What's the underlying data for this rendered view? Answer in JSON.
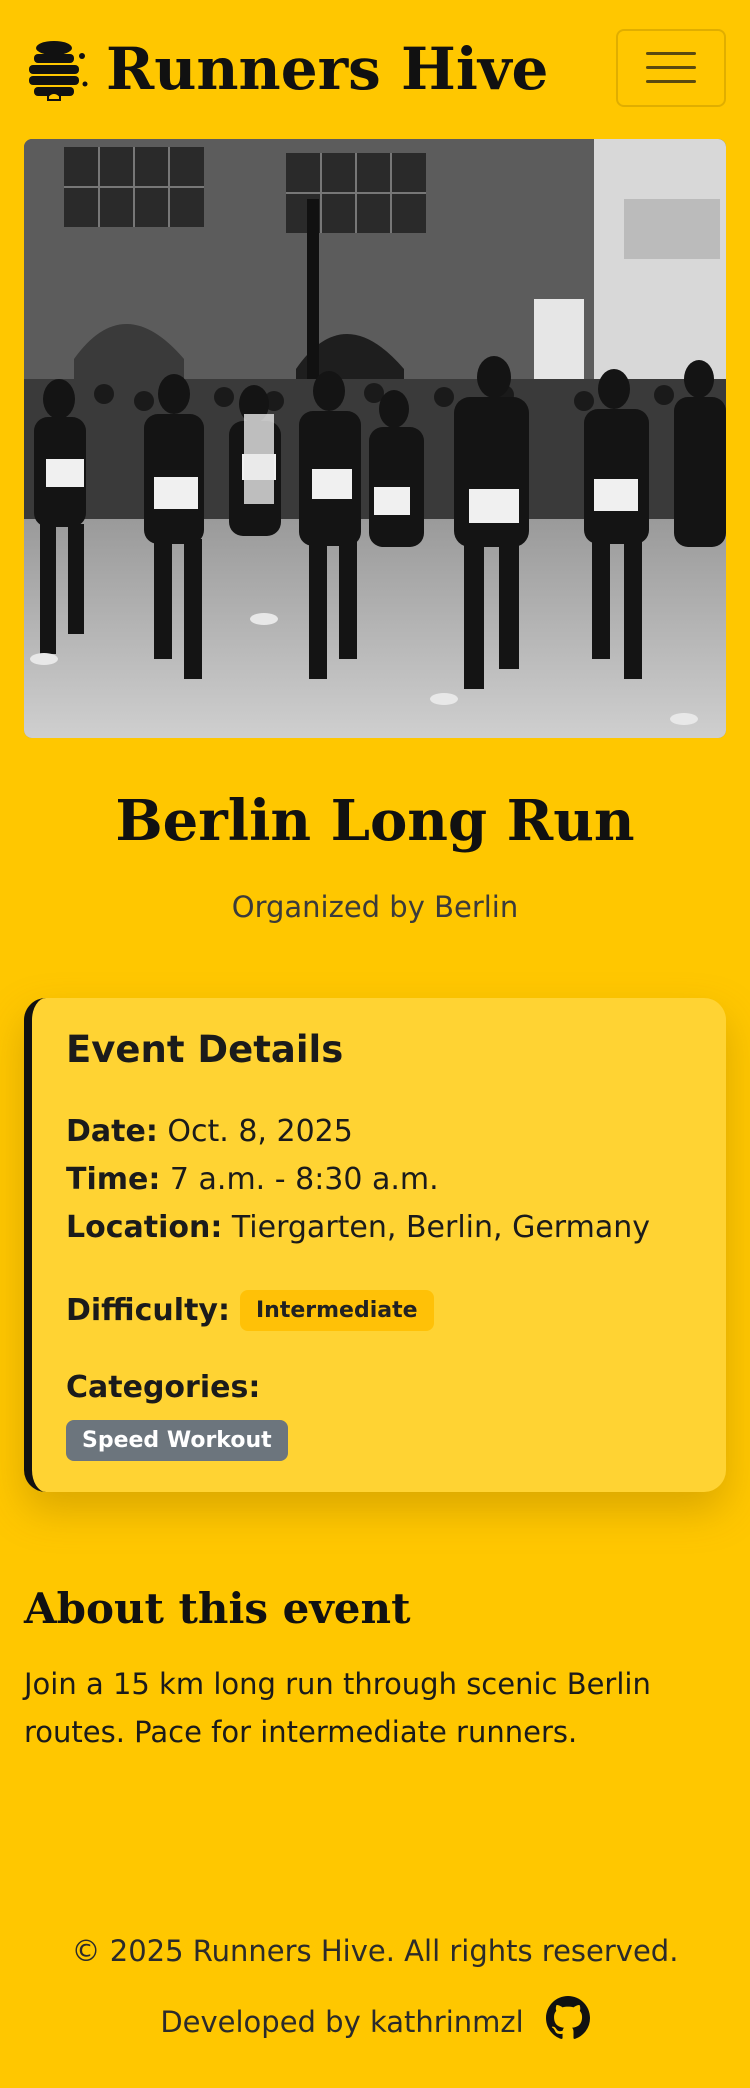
{
  "navbar": {
    "brand_name": "Runners Hive",
    "logo_icon": "beehive-icon",
    "menu_icon": "hamburger-menu-icon"
  },
  "hero": {
    "image_subject": "black and white photo of runners in a city marathon"
  },
  "event": {
    "title": "Berlin Long Run",
    "organizer": "Organized by Berlin"
  },
  "details": {
    "heading": "Event Details",
    "date_label": "Date:",
    "date_value": "Oct. 8, 2025",
    "time_label": "Time:",
    "time_value": "7 a.m. - 8:30 a.m.",
    "location_label": "Location:",
    "location_value": "Tiergarten, Berlin, Germany",
    "difficulty_label": "Difficulty:",
    "difficulty_value": "Intermediate",
    "categories_label": "Categories:",
    "categories": [
      "Speed Workout"
    ]
  },
  "about": {
    "heading": "About this event",
    "text": "Join a 15 km long run through scenic Berlin routes. Pace for intermediate runners."
  },
  "footer": {
    "copyright": "© 2025 Runners Hive. All rights reserved.",
    "developed_by": "Developed by kathrinmzl",
    "github_icon": "github-icon"
  },
  "colors": {
    "background": "#FFC700",
    "card": "#FFD333",
    "badge_intermediate": "#FFC107",
    "badge_category": "#6c757d"
  }
}
